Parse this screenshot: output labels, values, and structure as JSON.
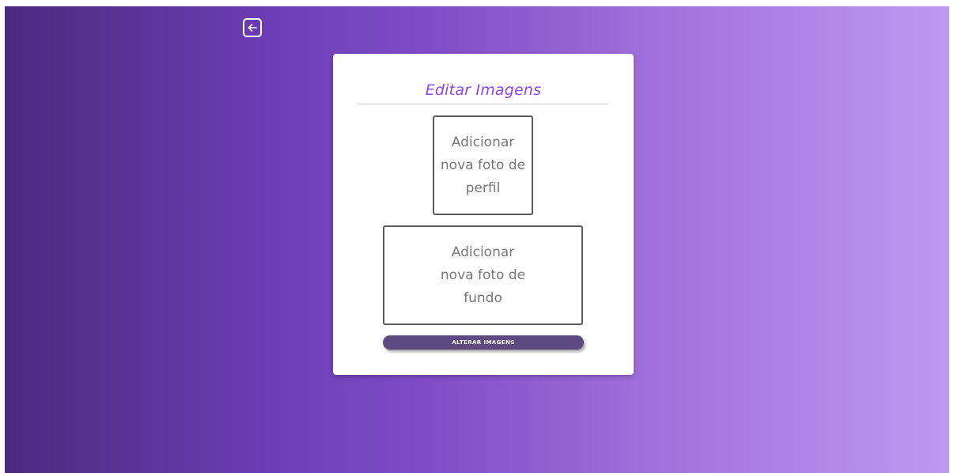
{
  "header": {
    "back_icon": "arrow-left-icon"
  },
  "card": {
    "title": "Editar Imagens",
    "profile_upload_label": "Adicionar nova foto de perfil",
    "background_upload_label": "Adicionar nova foto de fundo",
    "submit_label": "ALTERAR IMAGENS"
  },
  "colors": {
    "gradient_start": "#4b2a7d",
    "gradient_end": "#bf98f1",
    "title": "#8e44f0",
    "button": "#5e4a80"
  }
}
